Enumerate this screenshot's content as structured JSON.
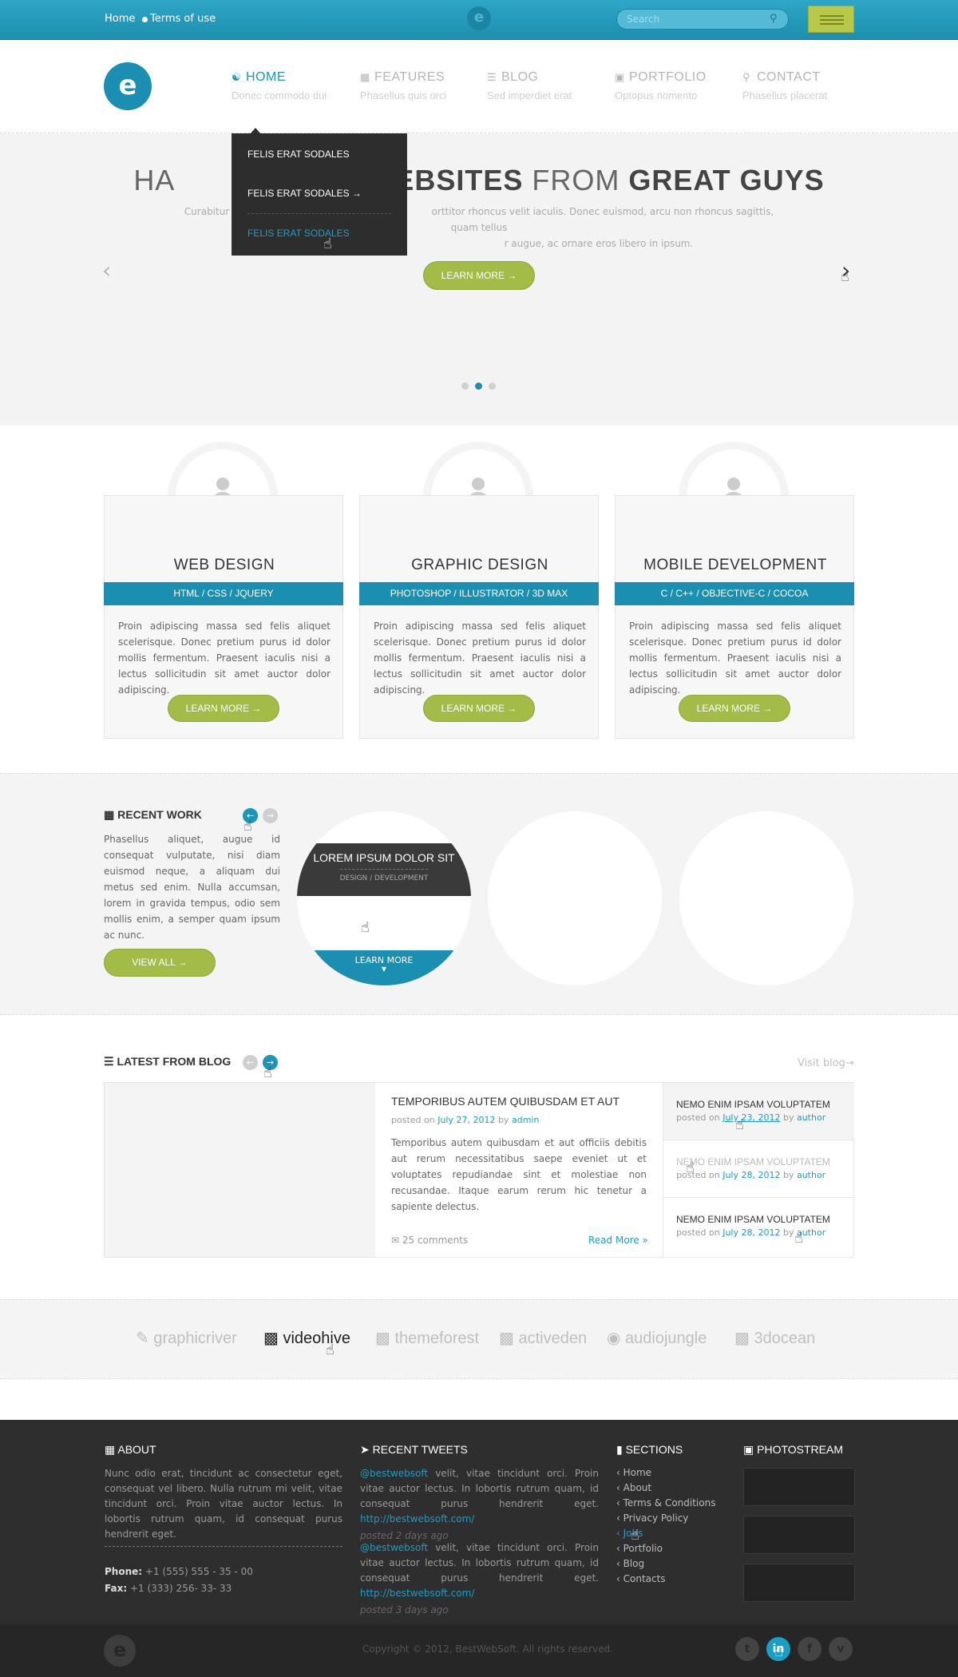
{
  "topbar": {
    "home": "Home",
    "terms": "Terms of use",
    "logo": "e",
    "search_placeholder": "Search"
  },
  "header": {
    "logo": "e"
  },
  "nav": [
    {
      "label": "HOME",
      "sub": "Donec commodo dui",
      "icon": "user-icon"
    },
    {
      "label": "FEATURES",
      "sub": "Phasellus quis orci",
      "icon": "grid-icon"
    },
    {
      "label": "BLOG",
      "sub": "Sed imperdiet erat",
      "icon": "list-icon"
    },
    {
      "label": "PORTFOLIO",
      "sub": "Optopus nomento",
      "icon": "image-icon"
    },
    {
      "label": "CONTACT",
      "sub": "Phasellus placerat",
      "icon": "pin-icon"
    }
  ],
  "dropdown": [
    "FELIS ERAT SODALES",
    "FELIS ERAT SODALES →",
    "FELIS ERAT SODALES"
  ],
  "hero": {
    "title_prefix": "HA",
    "title_bold1": "WEBSITES",
    "title_mid": " FROM ",
    "title_bold2": "GREAT GUYS",
    "text_left": "Curabitur ve",
    "text_right": "orttitor rhoncus velit iaculis. Donec euismod, arcu non rhoncus sagittis, quam tellus",
    "text_right2": "r augue, ac ornare eros libero in ipsum.",
    "button": "LEARN MORE →",
    "active_slide": 2
  },
  "services": [
    {
      "title": "WEB DESIGN",
      "tags": "HTML / CSS / JQUERY",
      "text": "Proin adipiscing massa sed felis aliquet scelerisque. Donec pretium purus id dolor mollis fermentum. Praesent iaculis nisi a lectus sollicitudin sit amet auctor dolor adipiscing.",
      "button": "LEARN MORE →"
    },
    {
      "title": "GRAPHIC DESIGN",
      "tags": "PHOTOSHOP / ILLUSTRATOR / 3D MAX",
      "text": "Proin adipiscing massa sed felis aliquet scelerisque. Donec pretium purus id dolor mollis fermentum. Praesent iaculis nisi a lectus sollicitudin sit amet auctor dolor adipiscing.",
      "button": "LEARN MORE →"
    },
    {
      "title": "MOBILE DEVELOPMENT",
      "tags": "C / C++ / OBJECTIVE-C / COCOA",
      "text": "Proin adipiscing massa sed felis aliquet scelerisque. Donec pretium purus id dolor mollis fermentum. Praesent iaculis nisi a lectus sollicitudin sit amet auctor dolor adipiscing.",
      "button": "LEARN MORE →"
    }
  ],
  "recent_work": {
    "heading": "RECENT WORK",
    "text": "Phasellus aliquet, augue id consequat vulputate, nisi diam euismod neque, a aliquam dui metus sed enim. Nulla accumsan, lorem in gravida tempus, odio sem mollis enim, a semper quam ipsum ac nunc.",
    "button": "VIEW ALL →",
    "item_title": "LOREM IPSUM DOLOR SIT",
    "item_cat": "DESIGN / DEVELOPMENT",
    "item_button": "LEARN MORE"
  },
  "blog": {
    "heading": "LATEST FROM BLOG",
    "visit": "Visit blog→",
    "main": {
      "title": "TEMPORIBUS AUTEM QUIBUSDAM ET AUT",
      "posted_on": "posted on",
      "date": "July 27, 2012",
      "by": "by",
      "author": "admin",
      "text": "Temporibus autem quibusdam et aut officiis debitis aut rerum necessitatibus saepe eveniet ut et voluptates repudiandae sint et molestiae non recusandae. Itaque earum rerum hic tenetur a sapiente delectus.",
      "comments": "25 comments",
      "read_more": "Read More »"
    },
    "side": [
      {
        "title": "NEMO ENIM IPSAM VOLUPTATEM",
        "date": "July 23, 2012",
        "author": "author"
      },
      {
        "title": "NEMO ENIM IPSAM VOLUPTATEM",
        "date": "July 28, 2012",
        "author": "author"
      },
      {
        "title": "NEMO ENIM IPSAM VOLUPTATEM",
        "date": "July 28, 2012",
        "author": "author"
      }
    ]
  },
  "partners": [
    "graphicriver",
    "videohive",
    "themeforest",
    "activeden",
    "audiojungle",
    "3docean"
  ],
  "footer": {
    "about": {
      "heading": "ABOUT",
      "text": "Nunc odio erat, tincidunt ac consectetur eget, consequat vel libero. Nulla rutrum mi velit, vitae tincidunt orci. Proin vitae auctor lectus. In lobortis rutrum quam, id consequat purus hendrerit eget.",
      "phone_label": "Phone:",
      "phone": "+1 (555) 555 - 35 - 00",
      "fax_label": "Fax:",
      "fax": "+1 (333) 256- 33- 33"
    },
    "tweets": {
      "heading": "RECENT TWEETS",
      "items": [
        {
          "handle": "@bestwebsoft",
          "text": " velit, vitae tincidunt orci. Proin vitae auctor lectus. In lobortis rutrum quam, id consequat purus hendrerit eget. ",
          "link": "http://bestwebsoft.com/",
          "time": "posted 2 days ago"
        },
        {
          "handle": "@bestwebsoft",
          "text": " velit, vitae tincidunt orci. Proin vitae auctor lectus. In lobortis rutrum quam, id consequat purus hendrerit eget. ",
          "link": "http://bestwebsoft.com/",
          "time": "posted 3 days ago"
        }
      ]
    },
    "sections": {
      "heading": "SECTIONS",
      "items": [
        "‹ Home",
        "‹ About",
        "‹ Terms & Conditions",
        "‹ Privacy Policy",
        "‹ Jobs",
        "‹ Portfolio",
        "‹ Blog",
        "‹ Contacts"
      ]
    },
    "photostream": {
      "heading": "PHOTOSTREAM"
    },
    "copyright": "Copyright © 2012, BestWebSoft. All rights reserved.",
    "logo": "e",
    "social": [
      "t",
      "in",
      "f",
      "v"
    ]
  },
  "colors": {
    "accent": "#1b8fb1",
    "green": "#a2bc47",
    "dark": "#2e2e2e"
  }
}
